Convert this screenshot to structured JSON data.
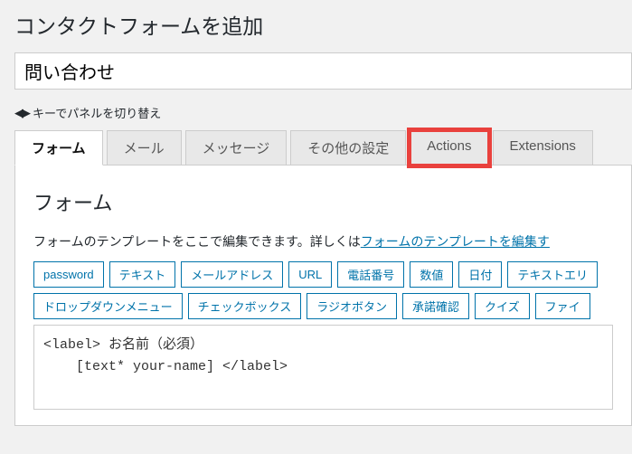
{
  "page_title": "コンタクトフォームを追加",
  "form_title_value": "問い合わせ",
  "hint_text": "キーでパネルを切り替え",
  "tabs": [
    {
      "label": "フォーム",
      "active": true
    },
    {
      "label": "メール"
    },
    {
      "label": "メッセージ"
    },
    {
      "label": "その他の設定"
    },
    {
      "label": "Actions",
      "highlighted": true
    },
    {
      "label": "Extensions"
    }
  ],
  "panel": {
    "heading": "フォーム",
    "desc_prefix": "フォームのテンプレートをここで編集できます。詳しくは",
    "desc_link": "フォームのテンプレートを編集す"
  },
  "tag_buttons_row1": [
    "password",
    "テキスト",
    "メールアドレス",
    "URL",
    "電話番号",
    "数値",
    "日付",
    "テキストエリ"
  ],
  "tag_buttons_row2": [
    "ドロップダウンメニュー",
    "チェックボックス",
    "ラジオボタン",
    "承諾確認",
    "クイズ",
    "ファイ"
  ],
  "code": "<label> お名前（必須）\n    [text* your-name] </label>"
}
